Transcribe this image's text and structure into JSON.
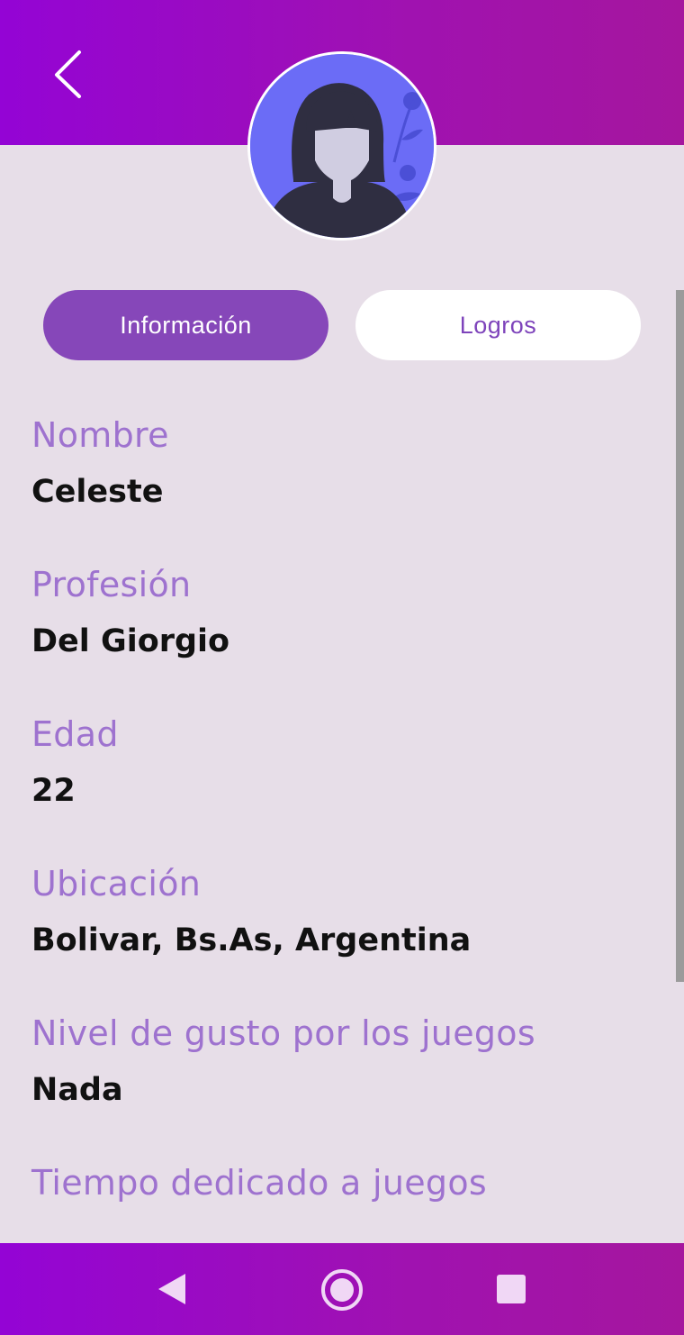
{
  "tabs": {
    "info_label": "Información",
    "logros_label": "Logros"
  },
  "profile": {
    "fields": [
      {
        "label": "Nombre",
        "value": "Celeste"
      },
      {
        "label": "Profesión",
        "value": "Del Giorgio"
      },
      {
        "label": "Edad",
        "value": "22"
      },
      {
        "label": "Ubicación",
        "value": "Bolivar, Bs.As, Argentina"
      },
      {
        "label": "Nivel de gusto por los juegos",
        "value": "Nada"
      },
      {
        "label": "Tiempo dedicado a juegos",
        "value": ""
      }
    ]
  },
  "colors": {
    "header_gradient_start": "#9404d5",
    "header_gradient_end": "#a5169e",
    "background": "#e7dee8",
    "active_tab": "#8647b9",
    "label_purple": "#9e72cf",
    "avatar_bg": "#6b6cf6"
  },
  "icons": {
    "back": "chevron-left-icon",
    "nav_back": "triangle-back-icon",
    "nav_home": "circle-home-icon",
    "nav_recents": "square-recents-icon"
  }
}
